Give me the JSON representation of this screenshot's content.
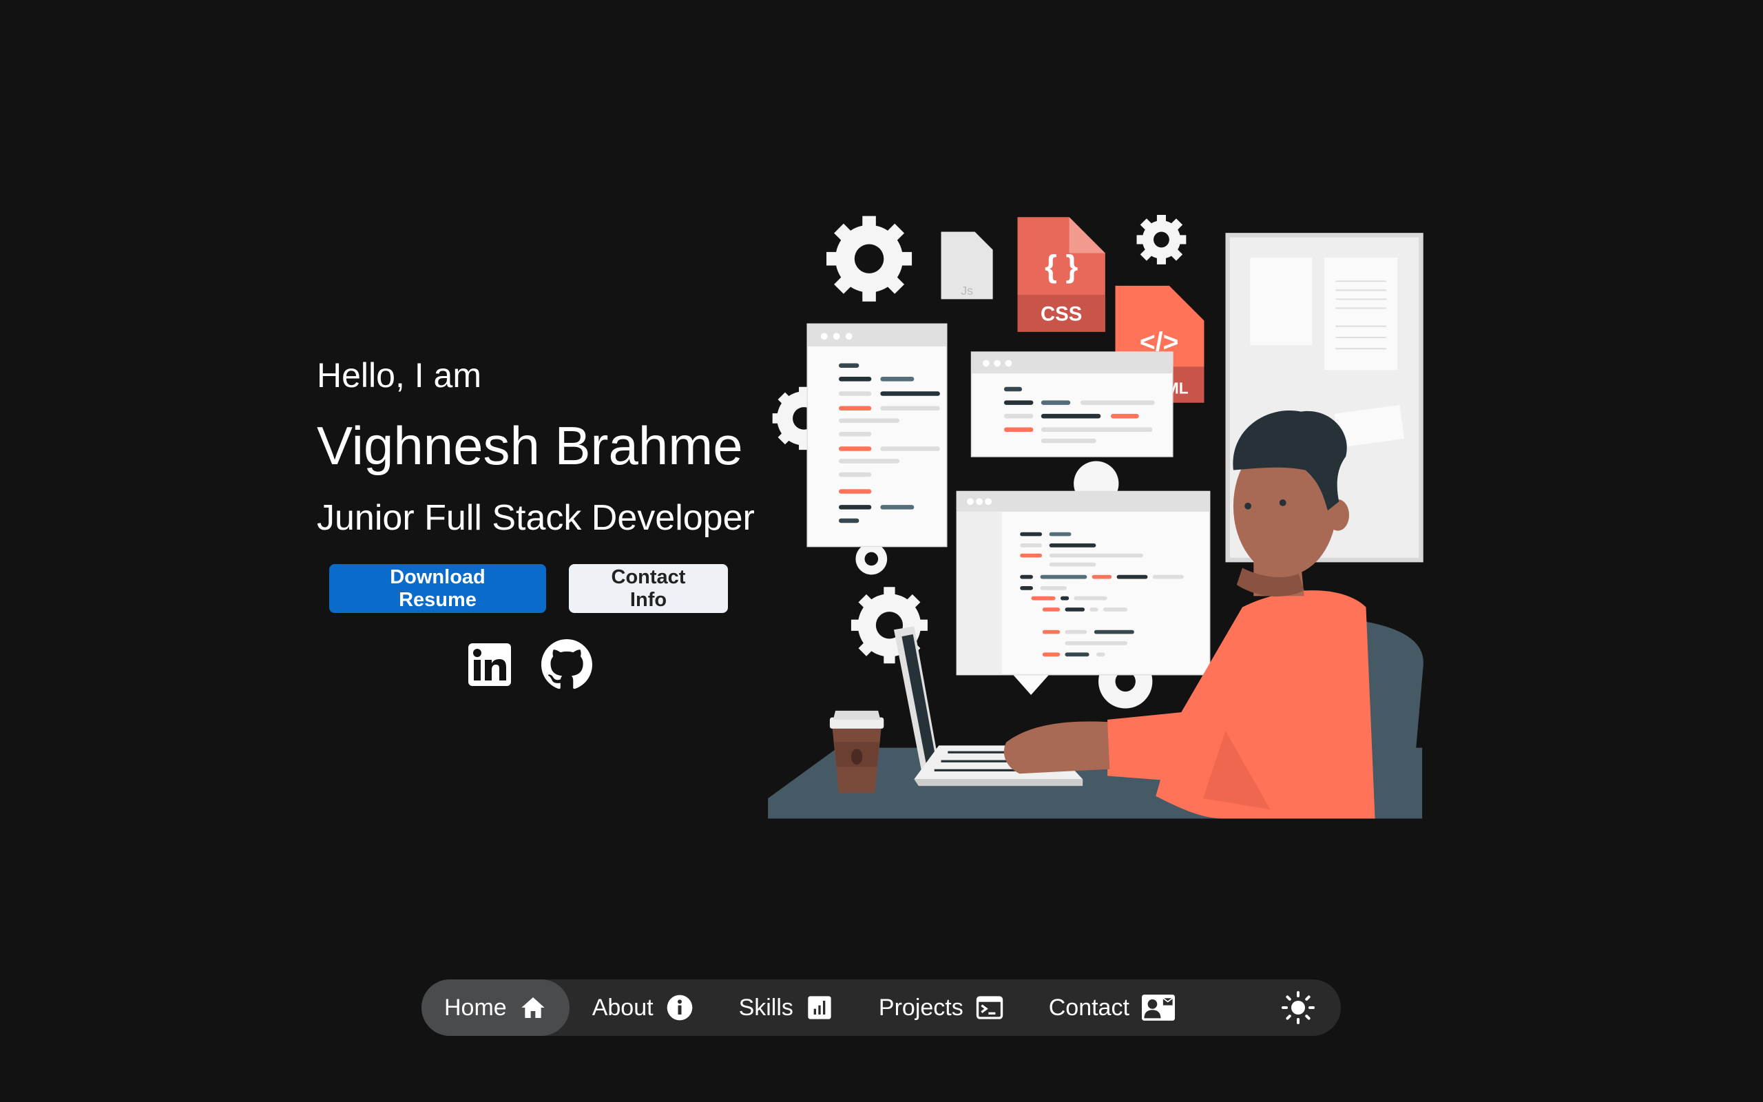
{
  "hero": {
    "greeting": "Hello, I am",
    "name": "Vighnesh Brahme",
    "role": "Junior Full Stack Developer",
    "download_label": "Download Resume",
    "contact_label": "Contact Info"
  },
  "socials": [
    {
      "icon": "linkedin-icon"
    },
    {
      "icon": "github-icon"
    }
  ],
  "illustration": {
    "css_label": "CSS",
    "css_brace": "{ }",
    "js_label": "Js",
    "html_label": "</>",
    "html_partial": "ML"
  },
  "nav": {
    "items": [
      {
        "label": "Home",
        "icon": "home-icon",
        "active": true
      },
      {
        "label": "About",
        "icon": "info-icon"
      },
      {
        "label": "Skills",
        "icon": "chart-icon"
      },
      {
        "label": "Projects",
        "icon": "terminal-icon"
      },
      {
        "label": "Contact",
        "icon": "contact-card-icon"
      }
    ],
    "theme_icon": "sun-icon"
  },
  "colors": {
    "background": "#121212",
    "primary": "#0b6bcb",
    "accent": "#ff7459",
    "nav_bg": "#2a2a2a",
    "nav_active": "#4a4b4d"
  }
}
